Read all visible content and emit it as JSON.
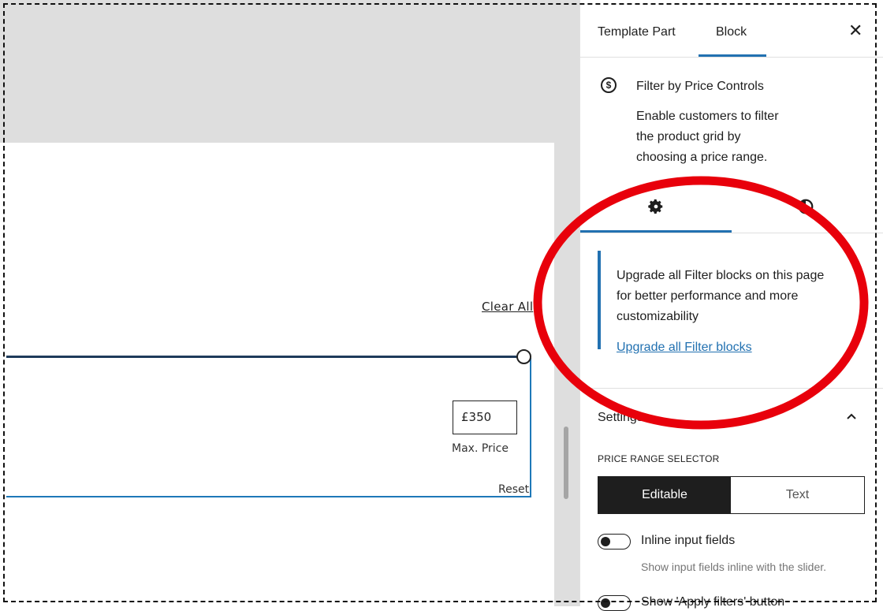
{
  "canvas": {
    "clear_all": "Clear All",
    "max_price_value": "£350",
    "max_price_label": "Max. Price",
    "reset": "Reset"
  },
  "sidebar": {
    "tabs": [
      {
        "label": "Template Part",
        "active": false
      },
      {
        "label": "Block",
        "active": true
      }
    ],
    "close_icon": "close-icon",
    "block_card": {
      "icon": "dollar-circle-icon",
      "title": "Filter by Price Controls",
      "description": "Enable customers to filter the product grid by choosing a price range."
    },
    "subtabs": [
      {
        "icon": "gear-icon",
        "active": true
      },
      {
        "icon": "styles-icon",
        "active": false
      }
    ],
    "notice": {
      "text": "Upgrade all Filter blocks on this page for better performance and more customizability",
      "link": "Upgrade all Filter blocks"
    },
    "settings": {
      "title": "Settings",
      "price_range_label": "PRICE RANGE SELECTOR",
      "options": [
        "Editable",
        "Text"
      ],
      "selected": "Editable",
      "inline_label": "Inline input fields",
      "inline_help": "Show input fields inline with the slider.",
      "apply_label": "Show 'Apply filters' button"
    }
  },
  "colors": {
    "accent": "#2271b1",
    "annotation": "#e8000b",
    "canvas_bg": "#dedede"
  }
}
